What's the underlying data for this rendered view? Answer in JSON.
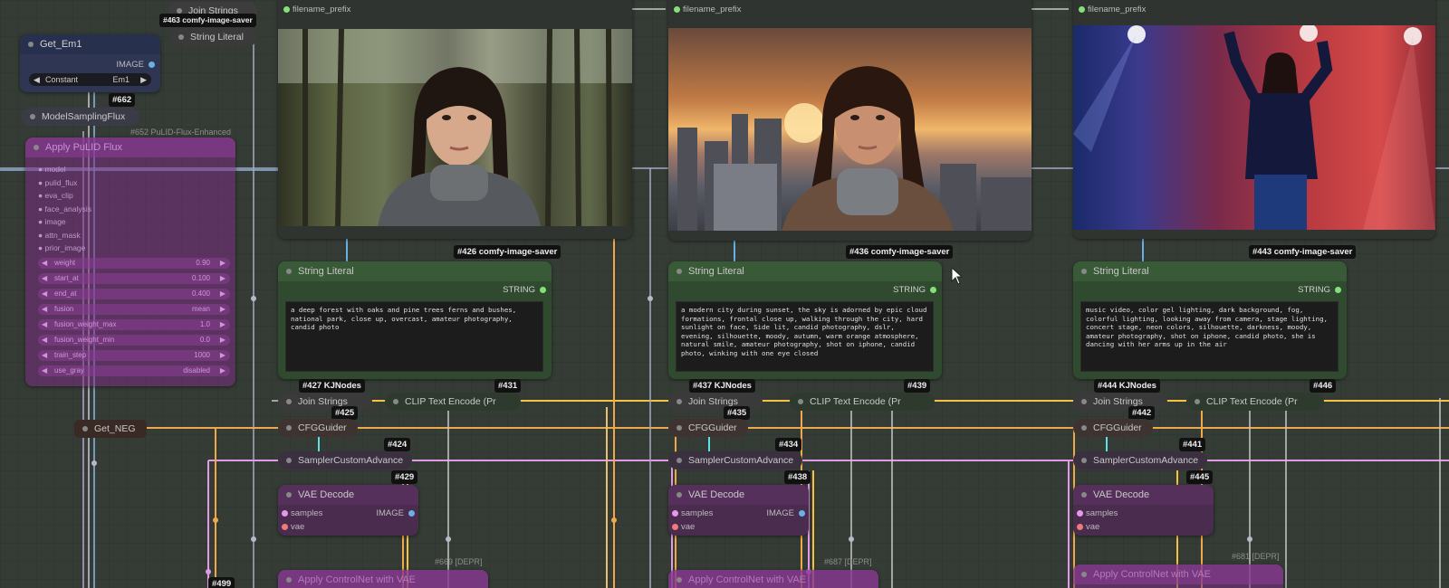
{
  "colors": {
    "canvas": "#353c35",
    "green_node": "#2f4a2f",
    "green_header": "#395a36",
    "purple_node": "#4a2c4f",
    "image_wire": "#6ab0e6",
    "clip_wire": "#f5c242",
    "conditioning_wire": "#f0a94a",
    "sampler_wire": "#e29ae8",
    "misc_wire": "#a0a0b0"
  },
  "left": {
    "join_strings_top": {
      "badge": "#463",
      "badge_suffix": "comfy-image-saver",
      "label": "Join Strings"
    },
    "string_literal_top": {
      "label": "String Literal"
    },
    "get_em1": {
      "title": "Get_Em1",
      "output": "IMAGE",
      "widget_mode": "Constant",
      "widget_value": "Em1",
      "badge": "#662"
    },
    "model_sampling": {
      "label": "ModelSamplingFlux"
    },
    "pulid": {
      "badge": "#652 PuLID-Flux-Enhanced",
      "title": "Apply PuLID Flux",
      "inputs": [
        "model",
        "pulid_flux",
        "eva_clip",
        "face_analysis",
        "image",
        "attn_mask",
        "prior_image"
      ],
      "widgets": [
        {
          "name": "weight",
          "value": "0.90"
        },
        {
          "name": "start_at",
          "value": "0.100"
        },
        {
          "name": "end_at",
          "value": "0.400"
        },
        {
          "name": "fusion",
          "value": "mean"
        },
        {
          "name": "fusion_weight_max",
          "value": "1.0"
        },
        {
          "name": "fusion_weight_min",
          "value": "0.0"
        },
        {
          "name": "train_step",
          "value": "1000"
        },
        {
          "name": "use_gray",
          "value": "disabled"
        }
      ]
    },
    "get_neg": {
      "label": "Get_NEG"
    },
    "bottom_badge": "#499"
  },
  "columns": [
    {
      "filename_prefix": "filename_prefix",
      "saver_badge": "#426 comfy-image-saver",
      "string_literal": {
        "title": "String Literal",
        "output": "STRING",
        "text": "a deep forest with oaks and pine trees ferns and bushes, national park, close up, overcast, amateur photography, candid photo"
      },
      "kj_badge": "#427 KJNodes",
      "clip_badge": "#431",
      "join_strings": "Join Strings",
      "join_badge": "#425",
      "clip_encode": "CLIP Text Encode (Pr",
      "cfg": "CFGGuider",
      "cfg_badge": "#424",
      "sampler": "SamplerCustomAdvance",
      "sampler_badge": "#429",
      "vae": {
        "title": "VAE Decode",
        "in1": "samples",
        "in2": "vae",
        "out": "IMAGE"
      },
      "bottom_dim": "#669 [DEPR]",
      "bottom_node": "Apply ControlNet with VAE"
    },
    {
      "filename_prefix": "filename_prefix",
      "saver_badge": "#436 comfy-image-saver",
      "string_literal": {
        "title": "String Literal",
        "output": "STRING",
        "text": "a modern city during sunset, the sky is adorned by epic cloud formations, frontal close up, walking through the city, hard sunlight on face, Side lit, candid photography, dslr, evening, silhouette, moody, autumn, warm orange atmosphere, natural smile, amateur photography, shot on iphone, candid photo,  winking with one eye closed"
      },
      "kj_badge": "#437 KJNodes",
      "clip_badge": "#439",
      "join_strings": "Join Strings",
      "join_badge": "#435",
      "clip_encode": "CLIP Text Encode (Pr",
      "cfg": "CFGGuider",
      "cfg_badge": "#434",
      "sampler": "SamplerCustomAdvance",
      "sampler_badge": "#438",
      "vae": {
        "title": "VAE Decode",
        "in1": "samples",
        "in2": "vae",
        "out": "IMAGE"
      },
      "bottom_dim": "#687 [DEPR]",
      "bottom_node": "Apply ControlNet with VAE"
    },
    {
      "filename_prefix": "filename_prefix",
      "saver_badge": "#443 comfy-image-saver",
      "string_literal": {
        "title": "String Literal",
        "output": "STRING",
        "text": "music video, color gel lighting, dark background, fog, colorful lighting, looking away from camera, stage lighting, concert stage, neon colors, silhouette, darkness, moody, amateur photography, shot on iphone, candid photo, she is dancing with her arms up in the air"
      },
      "kj_badge": "#444 KJNodes",
      "clip_badge": "#446",
      "join_strings": "Join Strings",
      "join_badge": "#442",
      "clip_encode": "CLIP Text Encode (Pr",
      "cfg": "CFGGuider",
      "cfg_badge": "#441",
      "sampler": "SamplerCustomAdvance",
      "sampler_badge": "#445",
      "vae": {
        "title": "VAE Decode",
        "in1": "samples",
        "in2": "vae",
        "out": "IMAGE"
      },
      "bottom_dim": "#681 [DEPR]",
      "bottom_node": "Apply ControlNet with VAE"
    }
  ]
}
